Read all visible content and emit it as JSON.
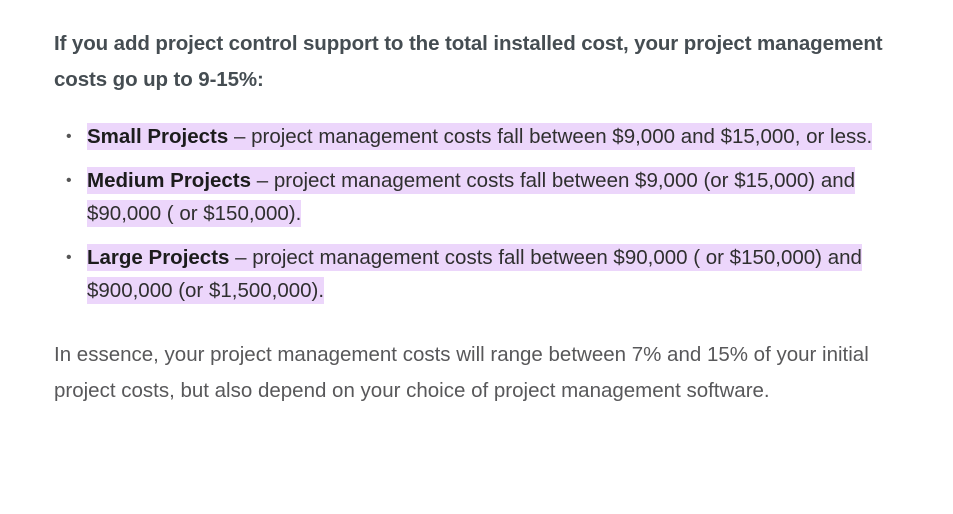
{
  "article": {
    "heading": "If you add project control support to the total installed cost, your project management costs go up to 9-15%:",
    "bullets": [
      {
        "term": "Small Projects",
        "text": " – project management costs fall between $9,000 and $15,000, or less."
      },
      {
        "term": "Medium Projects",
        "text": " – project management costs fall between $9,000 (or $15,000) and $90,000 ( or $150,000)."
      },
      {
        "term": "Large Projects",
        "text": " – project management costs fall between $90,000 ( or $150,000) and $900,000 (or $1,500,000)."
      }
    ],
    "summary": "In essence, your project management costs will range between 7% and 15% of your initial project costs, but also depend on your choice of project management software.",
    "bullet_glyph": "•"
  },
  "colors": {
    "highlight": "#ecd6fb",
    "heading": "#454d52",
    "body": "#58585a"
  }
}
